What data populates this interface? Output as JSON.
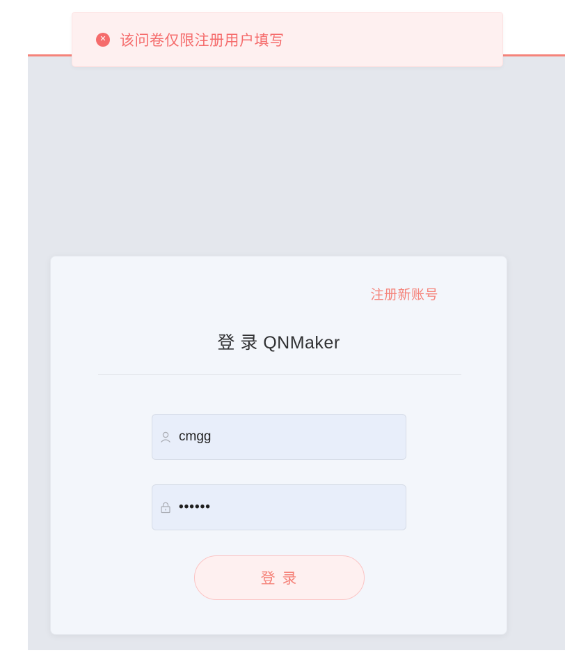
{
  "toast": {
    "message": "该问卷仅限注册用户填写",
    "icon": "error-circle-icon",
    "icon_glyph": "✕"
  },
  "login": {
    "register_link": "注册新账号",
    "title": "登 录 QNMaker",
    "username": {
      "value": "cmgg",
      "icon": "user-icon"
    },
    "password": {
      "value": "••••••",
      "icon": "lock-icon"
    },
    "submit_label": "登 录"
  },
  "colors": {
    "accent": "#f5837a",
    "error": "#f56c6c",
    "toast_bg": "#fef0f0",
    "page_bg": "#e4e7ed",
    "card_bg": "#f3f6fb",
    "input_bg": "#e8eefa"
  }
}
